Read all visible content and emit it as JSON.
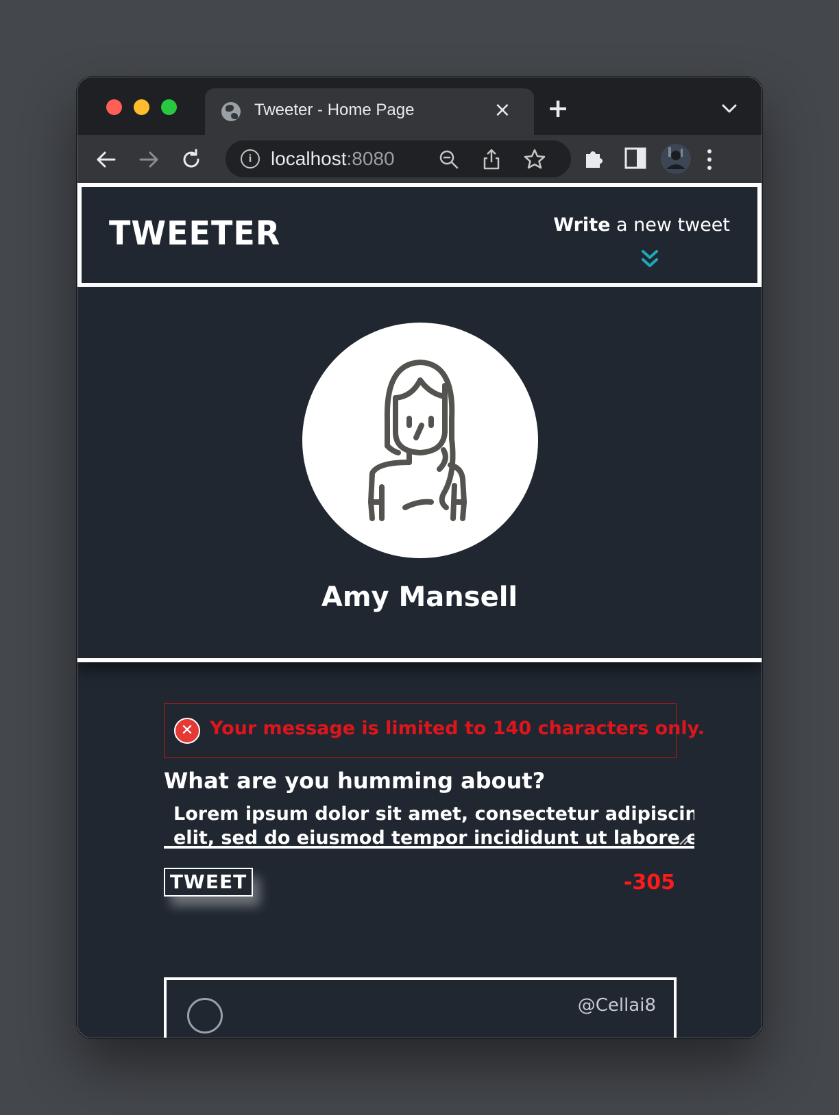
{
  "browser": {
    "tab_title": "Tweeter - Home Page",
    "tab_close_icon": "×",
    "new_tab_icon": "+",
    "url_host": "localhost",
    "url_port": ":8080"
  },
  "navbar": {
    "brand": "TWEETER",
    "write_bold": "Write",
    "write_rest": " a new tweet"
  },
  "profile": {
    "name": "Amy Mansell"
  },
  "compose": {
    "error_message": "Your message is limited to 140 characters only.",
    "label": "What are you humming about?",
    "text_line1": "Lorem ipsum dolor sit amet, consectetur adipiscing",
    "text_line2": "elit, sed do eiusmod tempor incididunt ut labore et",
    "button_label": "TWEET",
    "counter": "-305"
  },
  "tweets": [
    {
      "handle": "@Cellai8"
    }
  ],
  "colors": {
    "page_bg": "#202731",
    "error": "#e0151c",
    "accent": "#1fa8b8"
  }
}
